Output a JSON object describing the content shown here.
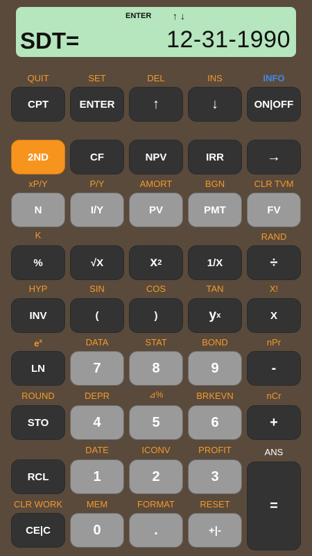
{
  "display": {
    "indicator_enter": "ENTER",
    "indicator_arrows": "↑ ↓",
    "label": "SDT=",
    "value": "12-31-1990"
  },
  "rows": {
    "r1": {
      "sec": [
        "QUIT",
        "SET",
        "DEL",
        "INS",
        "INFO"
      ],
      "keys": [
        "CPT",
        "ENTER",
        "↑",
        "↓",
        "ON|OFF"
      ]
    },
    "r2": {
      "keys": [
        "2ND",
        "CF",
        "NPV",
        "IRR",
        "→"
      ]
    },
    "r3": {
      "sec": [
        "xP/Y",
        "P/Y",
        "AMORT",
        "BGN",
        "CLR TVM"
      ],
      "keys": [
        "N",
        "I/Y",
        "PV",
        "PMT",
        "FV"
      ]
    },
    "r4": {
      "sec": [
        "K",
        "",
        "",
        "",
        "RAND"
      ],
      "keys": [
        "%",
        "√X",
        "x",
        "1/X",
        "÷"
      ],
      "sup": {
        "x2": "2"
      }
    },
    "r5": {
      "sec": [
        "HYP",
        "SIN",
        "COS",
        "TAN",
        "X!"
      ],
      "keys": [
        "INV",
        "(",
        ")",
        "y",
        "X"
      ],
      "sup": {
        "yx": "x"
      }
    },
    "r6": {
      "sec": [
        "e",
        "DATA",
        "STAT",
        "BOND",
        "nPr"
      ],
      "sup": {
        "ex": "x"
      },
      "keys": [
        "LN",
        "7",
        "8",
        "9",
        "-"
      ]
    },
    "r7": {
      "sec": [
        "ROUND",
        "DEPR",
        "⊿%",
        "BRKEVN",
        "nCr"
      ],
      "keys": [
        "STO",
        "4",
        "5",
        "6",
        "+"
      ]
    },
    "r8": {
      "sec": [
        "",
        "DATE",
        "ICONV",
        "PROFIT",
        "ANS"
      ],
      "keys": [
        "RCL",
        "1",
        "2",
        "3",
        "="
      ]
    },
    "r9": {
      "sec": [
        "CLR WORK",
        "MEM",
        "FORMAT",
        "RESET"
      ],
      "keys": [
        "CE|C",
        "0",
        ".",
        "+|-"
      ]
    }
  }
}
